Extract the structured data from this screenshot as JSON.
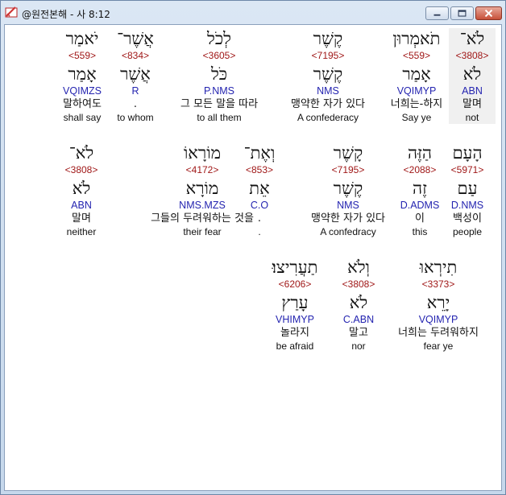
{
  "window": {
    "title": "@원전본해 - 사 8:12"
  },
  "controls": {
    "minimize": "minimize-icon",
    "maximize": "maximize-icon",
    "close": "close-icon"
  },
  "rows": [
    [
      {
        "heb": "לֹא־",
        "strong": "<3808>",
        "lemma": "לֹא",
        "parse": "ABN",
        "kor": "말며",
        "eng": "not",
        "highlight": true
      },
      {
        "heb": "תֹאמְרוּן",
        "strong": "<559>",
        "lemma": "אָמַר",
        "parse": "VQIMYP",
        "kor": "너희는-하지",
        "eng": "Say ye"
      },
      {
        "heb": "קֶשֶׁר",
        "strong": "<7195>",
        "lemma": "קֶשֶׁר",
        "parse": "NMS",
        "kor": "맹약한 자가 있다",
        "eng": "A confederacy"
      },
      {
        "heb": "לְכֹל",
        "strong": "<3605>",
        "lemma": "כֹּל",
        "parse": "P.NMS",
        "kor": "그 모든 말을 따라",
        "eng": "to all them"
      },
      {
        "heb": "אֲשֶׁר־",
        "strong": "<834>",
        "lemma": "אֲשֶׁר",
        "parse": "R",
        "kor": ".",
        "eng": "to whom"
      },
      {
        "heb": "יֹאמַר",
        "strong": "<559>",
        "lemma": "אָמַר",
        "parse": "VQIMZS",
        "kor": "말하여도",
        "eng": "shall say"
      }
    ],
    [
      {
        "heb": "הָעָם",
        "strong": "<5971>",
        "lemma": "עַם",
        "parse": "D.NMS",
        "kor": "백성이",
        "eng": "people"
      },
      {
        "heb": "הַזֶּה",
        "strong": "<2088>",
        "lemma": "זֶה",
        "parse": "D.ADMS",
        "kor": "이",
        "eng": "this"
      },
      {
        "heb": "קָשֶׁר",
        "strong": "<7195>",
        "lemma": "קֶשֶׁר",
        "parse": "NMS",
        "kor": "맹약한 자가 있다",
        "eng": "A confedracy"
      },
      {
        "heb": "וְאֶת־",
        "strong": "<853>",
        "lemma": "אֵת",
        "parse": "C.O",
        "kor": ".",
        "eng": "."
      },
      {
        "heb": "מוֹרָאוֹ",
        "strong": "<4172>",
        "lemma": "מוֹרָא",
        "parse": "NMS.MZS",
        "kor": "그들의 두려워하는 것을",
        "eng": "their fear"
      },
      {
        "heb": "לֹא־",
        "strong": "<3808>",
        "lemma": "לֹא",
        "parse": "ABN",
        "kor": "말며",
        "eng": "neither"
      }
    ],
    [
      {
        "heb": "תִירְאוּ",
        "strong": "<3373>",
        "lemma": "יָרֵא",
        "parse": "VQIMYP",
        "kor": "너희는 두려워하지",
        "eng": "fear ye"
      },
      {
        "heb": "וְלֹא",
        "strong": "<3808>",
        "lemma": "לֹא",
        "parse": "C.ABN",
        "kor": "말고",
        "eng": "nor"
      },
      {
        "heb": "תַעֲרִיצוּ׃",
        "strong": "<6206>",
        "lemma": "עָרַץ",
        "parse": "VHIMYP",
        "kor": "놀라지",
        "eng": "be afraid"
      }
    ]
  ]
}
